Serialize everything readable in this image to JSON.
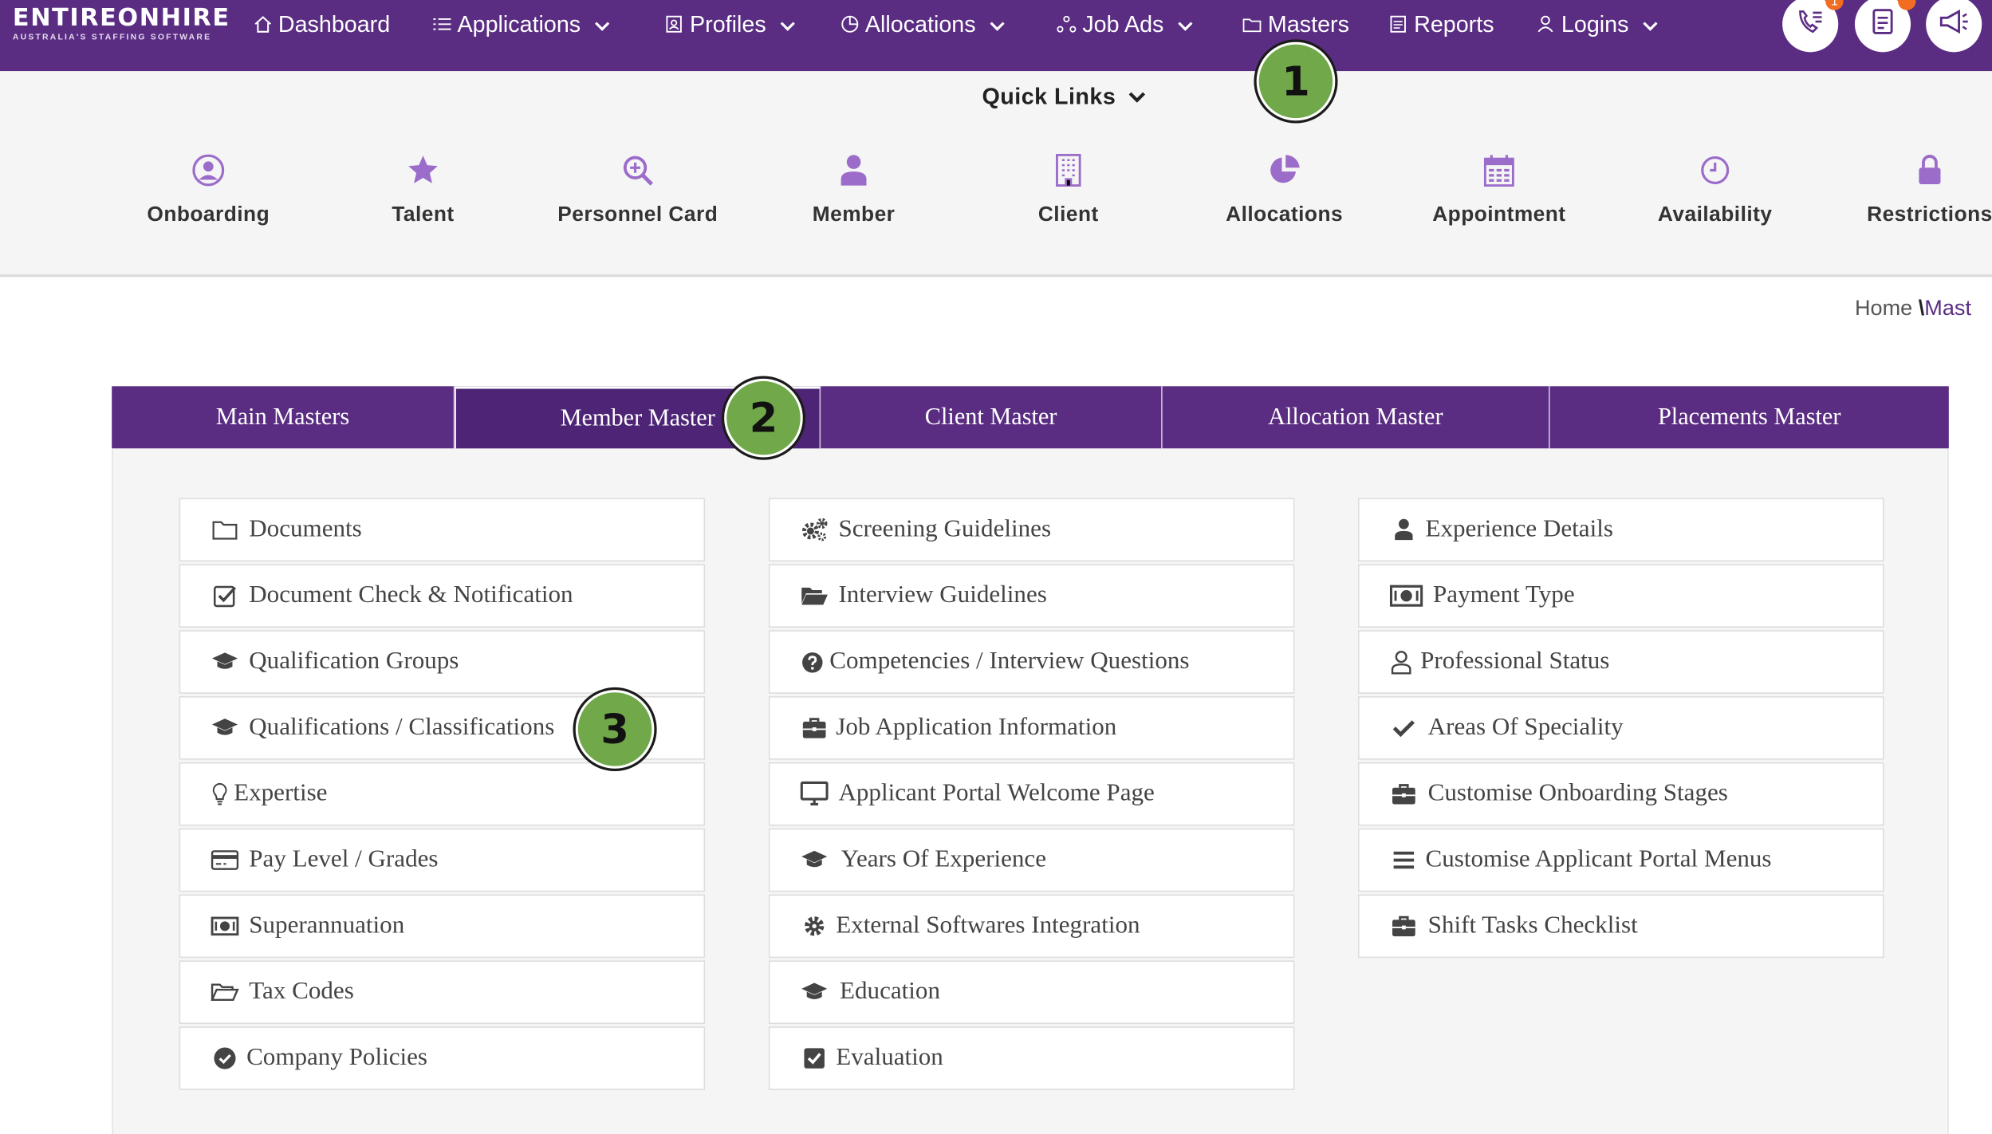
{
  "brand": {
    "name": "ENTIREONHIRE",
    "tagline": "AUSTRALIA'S STAFFING SOFTWARE"
  },
  "nav": {
    "items": [
      {
        "label": "Dashboard",
        "icon": "home-icon",
        "dropdown": false
      },
      {
        "label": "Applications",
        "icon": "list-icon",
        "dropdown": true
      },
      {
        "label": "Profiles",
        "icon": "id-card-icon",
        "dropdown": true
      },
      {
        "label": "Allocations",
        "icon": "pie-chart-icon",
        "dropdown": true
      },
      {
        "label": "Job Ads",
        "icon": "network-icon",
        "dropdown": true
      },
      {
        "label": "Masters",
        "icon": "folder-icon",
        "dropdown": false
      },
      {
        "label": "Reports",
        "icon": "document-icon",
        "dropdown": false
      },
      {
        "label": "Logins",
        "icon": "user-icon",
        "dropdown": true
      }
    ],
    "notifications": {
      "calls_badge": "1"
    }
  },
  "quick_links": {
    "title": "Quick Links",
    "items": [
      {
        "label": "Onboarding",
        "icon": "user-circle-icon"
      },
      {
        "label": "Talent",
        "icon": "star-icon"
      },
      {
        "label": "Personnel Card",
        "icon": "search-plus-icon"
      },
      {
        "label": "Member",
        "icon": "person-icon"
      },
      {
        "label": "Client",
        "icon": "building-icon"
      },
      {
        "label": "Allocations",
        "icon": "pie-chart-icon"
      },
      {
        "label": "Appointment",
        "icon": "calendar-icon"
      },
      {
        "label": "Availability",
        "icon": "clock-icon"
      },
      {
        "label": "Restrictions",
        "icon": "lock-icon"
      }
    ]
  },
  "breadcrumb": {
    "home": "Home",
    "separator": "\\",
    "current": "Mast"
  },
  "tabs": [
    {
      "label": "Main Masters",
      "active": false
    },
    {
      "label": "Member Master",
      "active": true
    },
    {
      "label": "Client Master",
      "active": false
    },
    {
      "label": "Allocation Master",
      "active": false
    },
    {
      "label": "Placements Master",
      "active": false
    }
  ],
  "columns": [
    [
      {
        "label": "Documents",
        "icon": "folder-icon"
      },
      {
        "label": "Document Check & Notification",
        "icon": "check-square-icon"
      },
      {
        "label": "Qualification Groups",
        "icon": "graduation-cap-icon"
      },
      {
        "label": "Qualifications / Classifications",
        "icon": "graduation-cap-icon"
      },
      {
        "label": "Expertise",
        "icon": "lightbulb-icon"
      },
      {
        "label": "Pay Level / Grades",
        "icon": "credit-card-icon"
      },
      {
        "label": "Superannuation",
        "icon": "money-icon"
      },
      {
        "label": "Tax Codes",
        "icon": "folder-open-icon"
      },
      {
        "label": "Company Policies",
        "icon": "check-circle-icon"
      }
    ],
    [
      {
        "label": "Screening Guidelines",
        "icon": "gears-icon"
      },
      {
        "label": "Interview Guidelines",
        "icon": "folder-open-icon"
      },
      {
        "label": "Competencies / Interview Questions",
        "icon": "question-circle-icon"
      },
      {
        "label": "Job Application Information",
        "icon": "briefcase-icon"
      },
      {
        "label": "Applicant Portal Welcome Page",
        "icon": "monitor-icon"
      },
      {
        "label": "Years Of Experience",
        "icon": "graduation-cap-icon"
      },
      {
        "label": "External Softwares Integration",
        "icon": "gear-icon"
      },
      {
        "label": "Education",
        "icon": "graduation-cap-icon"
      },
      {
        "label": "Evaluation",
        "icon": "check-square-icon"
      }
    ],
    [
      {
        "label": "Experience Details",
        "icon": "person-icon"
      },
      {
        "label": "Payment Type",
        "icon": "money-icon"
      },
      {
        "label": "Professional Status",
        "icon": "user-outline-icon"
      },
      {
        "label": "Areas Of Speciality",
        "icon": "check-icon"
      },
      {
        "label": "Customise Onboarding Stages",
        "icon": "briefcase-icon"
      },
      {
        "label": "Customise Applicant Portal Menus",
        "icon": "bars-icon"
      },
      {
        "label": "Shift Tasks Checklist",
        "icon": "briefcase-icon"
      }
    ]
  ],
  "steps": [
    "1",
    "2",
    "3"
  ],
  "colors": {
    "primary": "#5a2d83",
    "accent_icon": "#9b6cc9",
    "step_marker": "#70a84a",
    "badge": "#f26d21"
  }
}
